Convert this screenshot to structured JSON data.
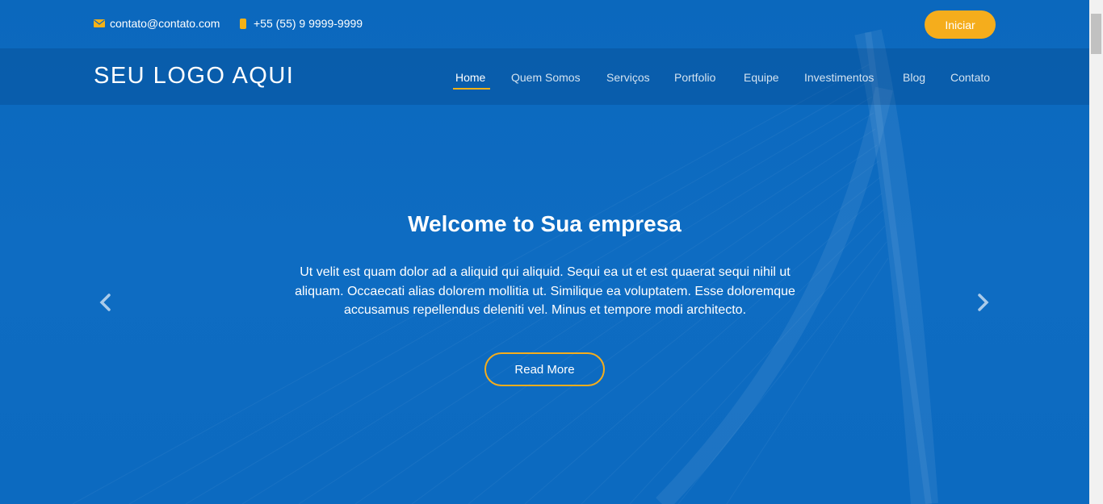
{
  "topbar": {
    "email": "contato@contato.com",
    "phone": "+55 (55) 9 9999-9999",
    "start_button": "Iniciar"
  },
  "brand": {
    "logo": "SEU LOGO AQUI"
  },
  "nav": {
    "items": [
      "Home",
      "Quem Somos",
      "Serviços",
      "Portfolio",
      "Equipe",
      "Investimentos",
      "Blog",
      "Contato"
    ],
    "active": "Home"
  },
  "hero": {
    "title": "Welcome to Sua empresa",
    "text": "Ut velit est quam dolor ad a aliquid qui aliquid. Sequi ea ut et est quaerat sequi nihil ut aliquam. Occaecati alias dolorem mollitia ut. Similique ea voluptatem. Esse doloremque accusamus repellendus deleniti vel. Minus et tempore modi architecto.",
    "cta": "Read More"
  },
  "icons": {
    "email": "mail-icon",
    "phone": "phone-icon",
    "prev": "chevron-left-icon",
    "next": "chevron-right-icon"
  },
  "colors": {
    "background": "#0d6bbf",
    "accent": "#f5ad1c"
  }
}
